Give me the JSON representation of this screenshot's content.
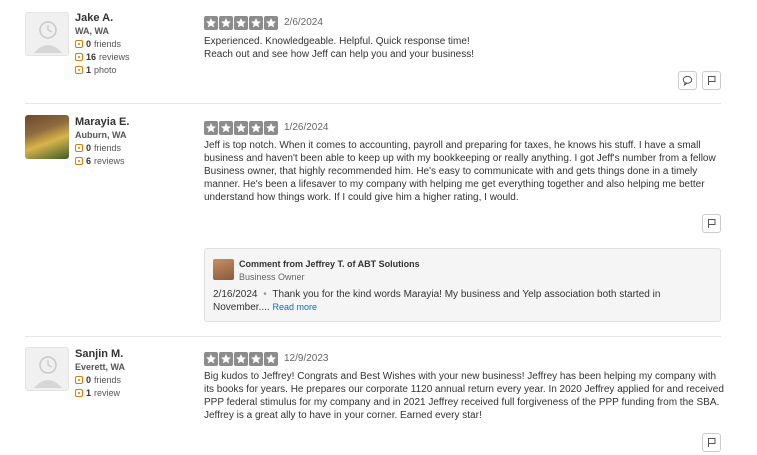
{
  "reviews": [
    {
      "user": {
        "name": "Jake A.",
        "location": "WA, WA",
        "friends": "0",
        "friends_label": "friends",
        "reviews": "16",
        "reviews_label": "reviews",
        "photos": "1",
        "photos_label": "photo"
      },
      "rating": 5,
      "date": "2/6/2024",
      "text": "Experienced. Knowledgeable. Helpful. Quick response time!\nReach out and see how Jeff can help you and your business!"
    },
    {
      "user": {
        "name": "Marayia E.",
        "location": "Auburn, WA",
        "friends": "0",
        "friends_label": "friends",
        "reviews": "6",
        "reviews_label": "reviews"
      },
      "rating": 5,
      "date": "1/26/2024",
      "text": "Jeff is top notch. When it comes to accounting, payroll and preparing for taxes, he knows his stuff. I have a small business and haven't been able to keep up with my bookkeeping or really anything. I got Jeff's number from a fellow Business owner, that highly recommended him. He's easy to communicate with and gets things done in a timely manner. He's been a lifesaver to my company with helping me get everything together and also helping me better understand how things work. If I could give him a higher rating, I would.",
      "owner_comment": {
        "title": "Comment from Jeffrey T. of ABT Solutions",
        "role": "Business Owner",
        "date": "2/16/2024",
        "separator": "•",
        "text": "Thank you for the kind words Marayia!  My business and Yelp association both started in November....",
        "read_more": "Read more"
      }
    },
    {
      "user": {
        "name": "Sanjin M.",
        "location": "Everett, WA",
        "friends": "0",
        "friends_label": "friends",
        "reviews": "1",
        "reviews_label": "review"
      },
      "rating": 5,
      "date": "12/9/2023",
      "text": "Big kudos to Jeffrey!  Congrats and Best Wishes with your new business!  Jeffrey has been helping my company with its books for years.  He prepares our corporate 1120 annual return every year.  In 2020 Jeffrey applied for and received PPP federal stimulus for my company and in 2021 Jeffrey received full forgiveness of the PPP funding from the SBA.  Jeffrey is a great ally to have in your corner.  Earned every star!"
    }
  ],
  "colors": {
    "star_fill": "#8c8c8c",
    "link": "#0073bb",
    "stat_icon": "#e07b00"
  },
  "icons": {
    "comment": "speech-bubble-icon",
    "flag": "flag-icon",
    "default_avatar": "default-user-avatar-icon"
  }
}
